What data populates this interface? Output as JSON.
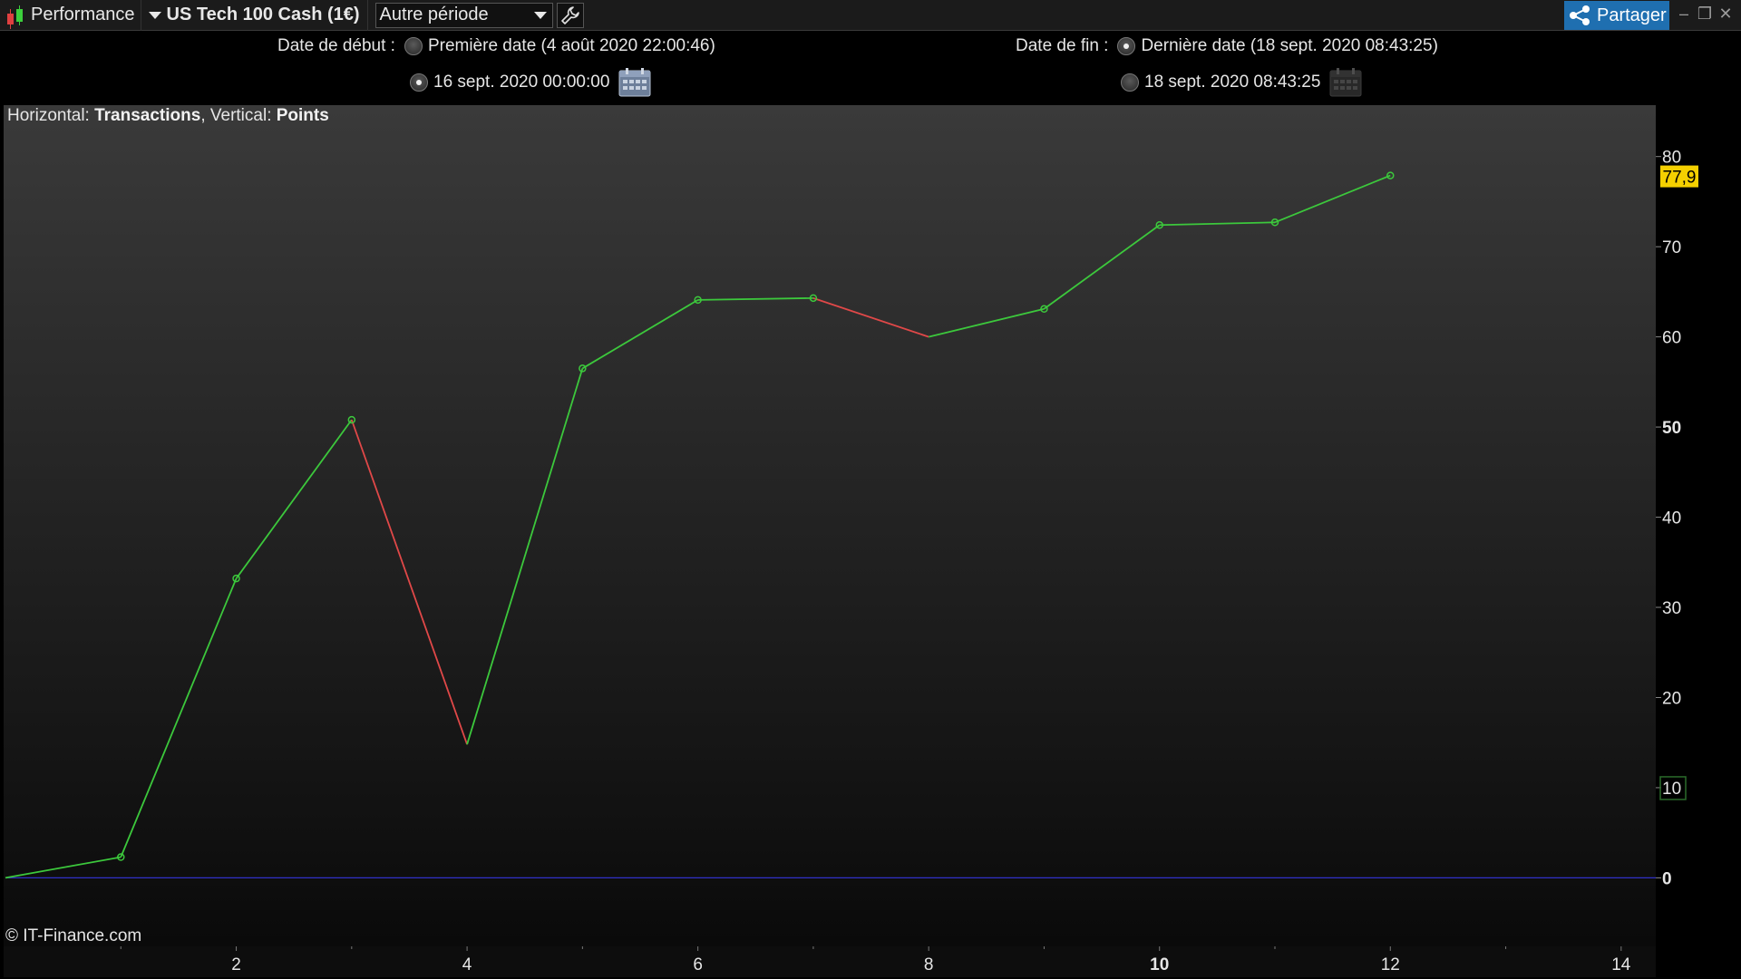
{
  "toolbar": {
    "app_label": "Performance",
    "instrument": "US Tech 100 Cash (1€)",
    "period": "Autre période",
    "share_label": "Partager"
  },
  "dates": {
    "start_label": "Date de début :",
    "start_first": "Première date (4 août 2020 22:00:46)",
    "start_custom": "16 sept. 2020 00:00:00",
    "end_label": "Date de fin :",
    "end_last": "Dernière date (18 sept. 2020 08:43:25)",
    "end_custom": "18 sept. 2020 08:43:25"
  },
  "chart_caption": {
    "h_prefix": "Horizontal: ",
    "h_value": "Transactions",
    "v_prefix": ", Vertical: ",
    "v_value": "Points"
  },
  "copyright": "© IT-Finance.com",
  "chart_data": {
    "type": "line",
    "xlabel": "Transactions",
    "ylabel": "Points",
    "x": [
      0,
      1,
      2,
      3,
      4,
      5,
      6,
      7,
      8,
      9,
      10,
      11,
      12
    ],
    "y": [
      0,
      2.3,
      33.2,
      50.8,
      14.8,
      56.5,
      64.1,
      64.3,
      60.0,
      63.1,
      72.4,
      72.7,
      77.9
    ],
    "x_ticks": [
      2,
      4,
      6,
      8,
      10,
      12,
      14
    ],
    "y_ticks": [
      0,
      10,
      20,
      30,
      40,
      50,
      60,
      70,
      80
    ],
    "xlim": [
      0,
      14.3
    ],
    "ylim": [
      -7.6,
      85.7
    ],
    "last_value_label": "77,9",
    "up_color": "#3cc83c",
    "down_color": "#e04848",
    "zero_line_color": "#3030c8",
    "last_value_badge_color": "#f5d000",
    "grid": false
  }
}
